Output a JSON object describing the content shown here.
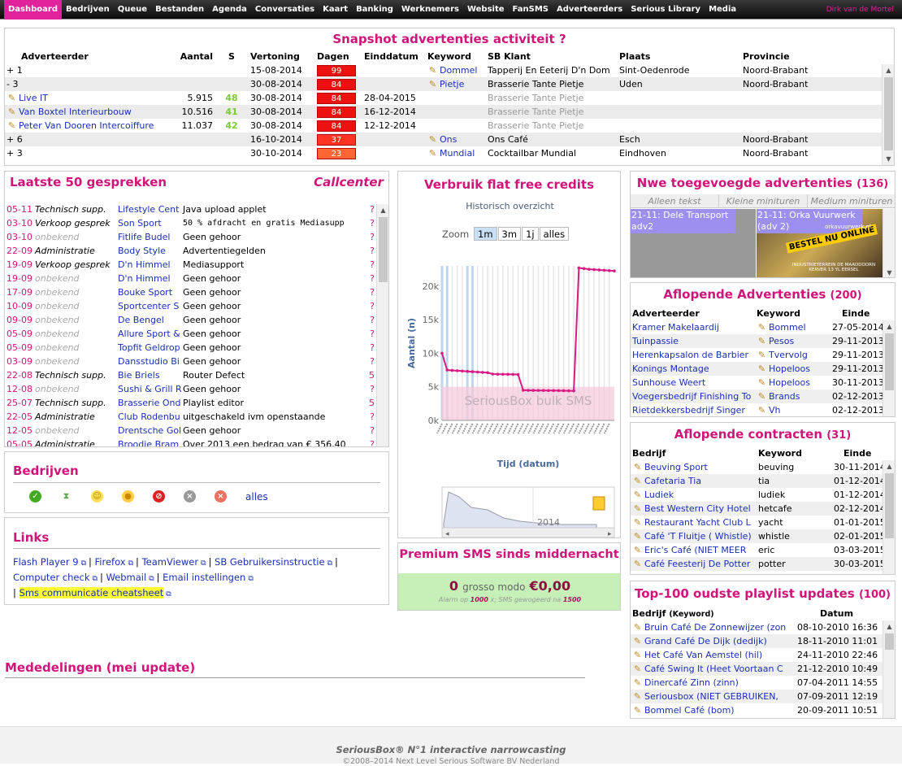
{
  "nav": {
    "items": [
      "Dashboard",
      "Bedrijven",
      "Queue",
      "Bestanden",
      "Agenda",
      "Conversaties",
      "Kaart",
      "Banking",
      "Werknemers",
      "Website",
      "FanSMS",
      "Adverteerders",
      "Serious Library",
      "Media"
    ],
    "user": "Dirk van de Mortel"
  },
  "snapshot": {
    "title": "Snapshot advertenties activiteit",
    "help": "?",
    "headers": [
      "Adverteerder",
      "Aantal",
      "S",
      "Vertoning",
      "Dagen",
      "Einddatum",
      "Keyword",
      "SB Klant",
      "Plaats",
      "Provincie"
    ],
    "rows": [
      {
        "adv": "+ 1",
        "aantal": "",
        "s": "",
        "vert": "15-08-2014",
        "dagen": "99",
        "eind": "",
        "kw": "Dommel",
        "klant": "Tapperij En Eeterij D'n Dom",
        "plaats": "Sint-Oedenrode",
        "prov": "Noord-Brabant",
        "link": false,
        "gray": false
      },
      {
        "adv": "- 3",
        "aantal": "",
        "s": "",
        "vert": "30-08-2014",
        "dagen": "84",
        "eind": "",
        "kw": "Pietje",
        "klant": "Brasserie Tante Pietje",
        "plaats": "Uden",
        "prov": "Noord-Brabant",
        "link": false,
        "gray": false
      },
      {
        "adv": "Live IT",
        "aantal": "5.915",
        "s": "48",
        "vert": "30-08-2014",
        "dagen": "84",
        "eind": "28-04-2015",
        "kw": "",
        "klant": "Brasserie Tante Pietje",
        "plaats": "",
        "prov": "",
        "link": true,
        "gray": true
      },
      {
        "adv": "Van Boxtel Interieurbouw",
        "aantal": "10.516",
        "s": "41",
        "vert": "30-08-2014",
        "dagen": "84",
        "eind": "16-12-2014",
        "kw": "",
        "klant": "Brasserie Tante Pietje",
        "plaats": "",
        "prov": "",
        "link": true,
        "gray": true
      },
      {
        "adv": "Peter Van Dooren Intercoiffure",
        "aantal": "11.037",
        "s": "42",
        "vert": "30-08-2014",
        "dagen": "84",
        "eind": "12-12-2014",
        "kw": "",
        "klant": "Brasserie Tante Pietje",
        "plaats": "",
        "prov": "",
        "link": true,
        "gray": true
      },
      {
        "adv": "+ 6",
        "aantal": "",
        "s": "",
        "vert": "16-10-2014",
        "dagen": "37",
        "eind": "",
        "kw": "Ons",
        "klant": "Ons Café",
        "plaats": "Esch",
        "prov": "Noord-Brabant",
        "link": false,
        "gray": false
      },
      {
        "adv": "+ 3",
        "aantal": "",
        "s": "",
        "vert": "30-10-2014",
        "dagen": "23",
        "eind": "",
        "kw": "Mundial",
        "klant": "Cocktailbar Mundial",
        "plaats": "Eindhoven",
        "prov": "Noord-Brabant",
        "link": false,
        "gray": false
      }
    ]
  },
  "gesprekken": {
    "title": "Laatste 50 gesprekken",
    "callcenter": "Callcenter",
    "rows": [
      {
        "d": "05-11",
        "type": "Technisch supp.",
        "bedrijf": "Lifestyle Cent",
        "msg": "Java upload applet",
        "q": "?"
      },
      {
        "d": "03-10",
        "type": "Verkoop gesprek",
        "bedrijf": "Son Sport",
        "msg": "50 % afdracht en gratis Mediasupp",
        "q": "?"
      },
      {
        "d": "03-10",
        "type": "onbekend",
        "bedrijf": "Fitlife Budel",
        "msg": "Geen gehoor",
        "q": "?"
      },
      {
        "d": "22-09",
        "type": "Administratie",
        "bedrijf": "Body Style",
        "msg": "Advertentiegelden",
        "q": "?"
      },
      {
        "d": "19-09",
        "type": "Verkoop gesprek",
        "bedrijf": "D'n Himmel",
        "msg": "Mediasupport",
        "q": "?"
      },
      {
        "d": "19-09",
        "type": "onbekend",
        "bedrijf": "D'n Himmel",
        "msg": "Geen gehoor",
        "q": "?"
      },
      {
        "d": "17-09",
        "type": "onbekend",
        "bedrijf": "Bouke Sport",
        "msg": "Geen gehoor",
        "q": "?"
      },
      {
        "d": "10-09",
        "type": "onbekend",
        "bedrijf": "Sportcenter S",
        "msg": "Geen gehoor",
        "q": "?"
      },
      {
        "d": "09-09",
        "type": "onbekend",
        "bedrijf": "De Bengel",
        "msg": "Geen gehoor",
        "q": "?"
      },
      {
        "d": "05-09",
        "type": "onbekend",
        "bedrijf": "Allure Sport &",
        "msg": "Geen gehoor",
        "q": "?"
      },
      {
        "d": "05-09",
        "type": "onbekend",
        "bedrijf": "Topfit Geldrop",
        "msg": "Geen gehoor",
        "q": "?"
      },
      {
        "d": "03-09",
        "type": "onbekend",
        "bedrijf": "Dansstudio Bi",
        "msg": "Geen gehoor",
        "q": "?"
      },
      {
        "d": "22-08",
        "type": "Technisch supp.",
        "bedrijf": "Bie Briels",
        "msg": "Router Defect",
        "q": "5"
      },
      {
        "d": "12-08",
        "type": "onbekend",
        "bedrijf": "Sushi & Grill R",
        "msg": "Geen gehoor",
        "q": "?"
      },
      {
        "d": "25-07",
        "type": "Technisch supp.",
        "bedrijf": "Brasserie Ond",
        "msg": "Playlist editor",
        "q": "5"
      },
      {
        "d": "22-05",
        "type": "Administratie",
        "bedrijf": "Club Rodenbu",
        "msg": "uitgeschakeld ivm openstaande",
        "q": "?"
      },
      {
        "d": "12-05",
        "type": "onbekend",
        "bedrijf": "Drentsche Gol",
        "msg": "Geen gehoor",
        "q": "?"
      },
      {
        "d": "05-05",
        "type": "Administratie",
        "bedrijf": "Broodje Bram",
        "msg": "Over 2013 een bedrag van € 356,40",
        "q": "?"
      }
    ]
  },
  "credits": {
    "title": "Verbruik flat free credits",
    "subtitle": "Historisch overzicht",
    "zoom_label": "Zoom",
    "zoom": [
      "1m",
      "3m",
      "1j",
      "alles"
    ],
    "band_label": "SeriousBox bulk SMS",
    "navigator_year": "2014"
  },
  "chart_data": {
    "type": "line",
    "title": "Historisch overzicht",
    "xlabel": "Tijd (datum)",
    "ylabel": "Aantal (n)",
    "y_ticks": [
      "0k",
      "5k",
      "10k",
      "15k",
      "20k"
    ],
    "ylim": [
      0,
      23000
    ],
    "series": [
      {
        "values": [
          10000,
          7500,
          7450,
          7400,
          7350,
          7300,
          7250,
          7200,
          7150,
          7100,
          6900,
          6880,
          6870,
          6860,
          6850,
          6840,
          4500,
          4480,
          4470,
          4460,
          4455,
          4450,
          4440,
          4430,
          4420,
          4410,
          4400,
          22700,
          22600,
          22500,
          22450,
          22400,
          22350,
          22300,
          22250
        ]
      }
    ]
  },
  "premium": {
    "title": "Premium SMS sinds middernacht",
    "count": "0",
    "mid": "grosso modo",
    "amount": "€0,00",
    "note_pre": "Alarm op",
    "alarm": "1000",
    "note_mid": "x; SMS gewogeerd na",
    "cap": "1500"
  },
  "bedrijven": {
    "title": "Bedrijven",
    "icons": [
      "check-icon",
      "hourglass-icon",
      "smile-icon",
      "neutral-icon",
      "forbidden-icon",
      "grey-x-icon",
      "red-x-icon"
    ],
    "all": "alles"
  },
  "links": {
    "title": "Links",
    "items": [
      "Flash Player 9",
      "Firefox",
      "TeamViewer",
      "SB Gebruikersinstructie",
      "Computer check",
      "Webmail",
      "Email instellingen",
      "Sms communicatie cheatsheet"
    ],
    "sep": "|"
  },
  "mededelingen": {
    "title": "Mededelingen (mei update)"
  },
  "nwe": {
    "title": "Nwe toegevoegde advertenties",
    "count": "(136)",
    "tabs": [
      "Alleen tekst",
      "Kleine minituren",
      "Medium minituren"
    ],
    "thumb1": "21-11: Dele Transport adv2",
    "thumb2": "21-11: Orka Vuurwerk (adv 2)",
    "banner": "BESTEL NU ONLINE",
    "banner_url": "orkavuurwerk.nl",
    "banner_foot": "INDUSTRIETERREIN DE MAADDOORN KERVER 13 YL EERSEL"
  },
  "aflopend_adv": {
    "title": "Aflopende Advertenties",
    "count": "(200)",
    "headers": [
      "Adverteerder",
      "Keyword",
      "Einde"
    ],
    "rows": [
      [
        "Kramer Makelaardij",
        "Bommel",
        "27-05-2014"
      ],
      [
        "Tuinpassie",
        "Pesos",
        "29-11-2013"
      ],
      [
        "Herenkapsalon de Barbier",
        "Tvervolg",
        "29-11-2013"
      ],
      [
        "Konings Montage",
        "Hopeloos",
        "29-11-2013"
      ],
      [
        "Sunhouse Weert",
        "Hopeloos",
        "30-11-2013"
      ],
      [
        "Voegersbedrijf Finishing To",
        "Brands",
        "02-12-2013"
      ],
      [
        "Rietdekkersbedrijf Singer",
        "Vh",
        "02-12-2013"
      ]
    ]
  },
  "aflopend_con": {
    "title": "Aflopende contracten",
    "count": "(31)",
    "headers": [
      "Bedrijf",
      "Keyword",
      "Einde"
    ],
    "rows": [
      [
        "Beuving Sport",
        "beuving",
        "30-11-2014"
      ],
      [
        "Cafetaria Tia",
        "tia",
        "01-12-2014"
      ],
      [
        "Ludiek",
        "ludiek",
        "01-12-2014"
      ],
      [
        "Best Western City Hotel",
        "hetcafe",
        "02-12-2014"
      ],
      [
        "Restaurant Yacht Club L",
        "yacht",
        "01-01-2015"
      ],
      [
        "Café 'T Fluitje ( Whistle)",
        "whistle",
        "02-01-2015"
      ],
      [
        "Eric's Café (NIET MEER",
        "eric",
        "03-03-2015"
      ],
      [
        "Café Feesterij De Potter",
        "potter",
        "30-03-2015"
      ]
    ]
  },
  "top100": {
    "title": "Top-100 oudste playlist updates",
    "count": "(100)",
    "h1": "Bedrijf",
    "h1b": "(Keyword)",
    "h2": "Datum",
    "rows": [
      [
        "Bruin Café De Zonnewijzer (zon",
        "08-10-2010 16:36"
      ],
      [
        "Grand Café De Dijk (dedijk)",
        "18-11-2010 11:01"
      ],
      [
        "Het Café Van Aemstel (hil)",
        "24-11-2010 22:46"
      ],
      [
        "Café Swing It (Heet Voortaan C",
        "21-12-2010 10:49"
      ],
      [
        "Dinercafé Zinn (zinn)",
        "07-04-2011 14:55"
      ],
      [
        "Seriousbox (NIET GEBRUIKEN,",
        "07-09-2011 12:19"
      ],
      [
        "Bommel Café (bom)",
        "20-09-2011 10:51"
      ]
    ]
  },
  "footer": {
    "line1": "SeriousBox® N°1 interactive narrowcasting",
    "line2": "©2008–2014 Next Level Serious Software BV Nederland"
  }
}
